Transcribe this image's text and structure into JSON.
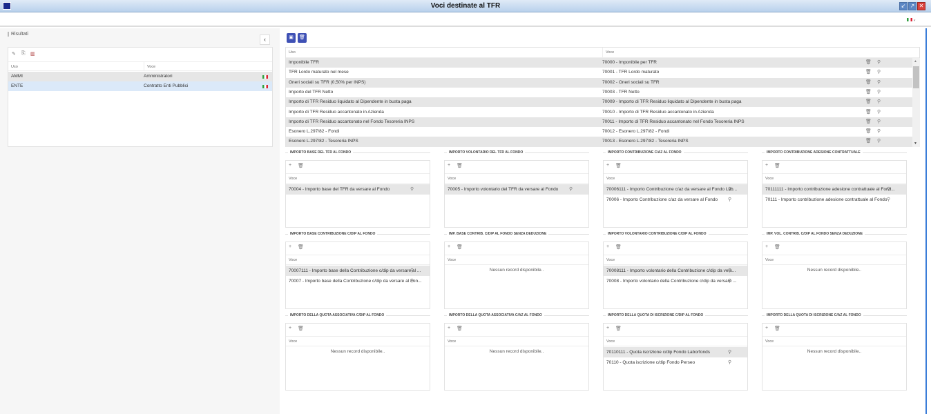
{
  "window": {
    "title": "Voci destinate al TFR",
    "buttons": [
      "restore",
      "maximize",
      "close"
    ]
  },
  "topbar": {
    "language": "it",
    "language_arrow": "▾"
  },
  "left": {
    "title": "Risultati",
    "collapse_label": "‹",
    "columns": [
      "Uso",
      "Voce"
    ],
    "rows": [
      {
        "uso": "AMMI",
        "voce": "Amministratori"
      },
      {
        "uso": "ENTE",
        "voce": "Contratto Enti Pubblici"
      }
    ]
  },
  "main": {
    "columns": [
      "Uso",
      "Voce"
    ],
    "rows": [
      {
        "uso": "Imponibile TFR",
        "voce": "70000 - Imponibile per TFR"
      },
      {
        "uso": "TFR Lordo maturato nel mese",
        "voce": "70001 - TFR Lordo maturato"
      },
      {
        "uso": "Oneri sociali su TFR (0,50% per INPS)",
        "voce": "70002 - Oneri sociali su TFR"
      },
      {
        "uso": "Importo del TFR Netto",
        "voce": "70003 - TFR Netto"
      },
      {
        "uso": "Importo di TFR Residuo liquidato al Dipendente in busta paga",
        "voce": "70009 - Importo di TFR Residuo liquidato al Dipendente in busta paga"
      },
      {
        "uso": "Importo di TFR Residuo accantonato in Azienda",
        "voce": "70010 - Importo di TFR Residuo accantonato in Azienda"
      },
      {
        "uso": "Importo di TFR Residuo accantonato nel Fondo Tesoreria INPS",
        "voce": "70011 - Importo di TFR Residuo accantonato nel Fondo Tesoreria INPS"
      },
      {
        "uso": "Esonero L.297/82 - Fondi",
        "voce": "70012 - Esonero L.297/82 - Fondi"
      },
      {
        "uso": "Esonero L.297/82 - Tesoreria INPS",
        "voce": "70013 - Esonero L.297/82 - Tesoreria INPS"
      }
    ]
  },
  "panels": [
    {
      "title": "IMPORTO BASE DEL TFR AL FONDO",
      "header": "Voce",
      "rows": [
        "70004 - Importo base del TFR da versare al Fondo"
      ]
    },
    {
      "title": "IMPORTO VOLONTARIO DEL TFR AL FONDO",
      "header": "Voce",
      "rows": [
        "70005 - Importo volontario del TFR da versare al Fondo"
      ]
    },
    {
      "title": "IMPORTO CONTRIBUZIONE C/AZ AL FONDO",
      "header": "Voce",
      "rows": [
        "70006111 - Importo Contribuzione c/az da versare al Fondo Lab...",
        "70006 - Importo Contribuzione c/az da versare al Fondo"
      ]
    },
    {
      "title": "IMPORTO CONTRIBUZIONE ADESIONE CONTRATTUALE",
      "header": "Voce",
      "rows": [
        "70111111 - Importo contribuzione adesione contrattuale al Fond...",
        "70111 - Importo contribuzione adesione contrattuale al Fondo"
      ]
    },
    {
      "title": "IMPORTO BASE CONTRIBUZIONE C/DIP AL FONDO",
      "header": "Voce",
      "rows": [
        "70007111 - Importo base della Contribuzione c/dip da versare al ...",
        "70007 - Importo base della Contribuzione c/dip da versare al Fon..."
      ]
    },
    {
      "title": "IMP. BASE CONTRIB. C/DIP AL FONDO SENZA DEDUZIONE",
      "header": "Voce",
      "rows": [],
      "empty": "Nessun record disponibile.."
    },
    {
      "title": "IMPORTO VOLONTARIO CONTRIBUZIONE C/DIP AL FONDO",
      "header": "Voce",
      "rows": [
        "70008111 - Importo volontario della Contribuzione c/dip da vers...",
        "70008 - Importo volontario della Contribuzione c/dip da versare ..."
      ]
    },
    {
      "title": "IMP. VOL. CONTRIB. C/DIP AL FONDO SENZA DEDUZIONE",
      "header": "Voce",
      "rows": [],
      "empty": "Nessun record disponibile.."
    },
    {
      "title": "IMPORTO DELLA QUOTA ASSOCIATIVA C/DIP AL FONDO",
      "header": "Voce",
      "rows": [],
      "empty": "Nessun record disponibile.."
    },
    {
      "title": "IMPORTO DELLA QUOTA ASSOCIATIVA C/AZ AL FONDO",
      "header": "Voce",
      "rows": [],
      "empty": "Nessun record disponibile.."
    },
    {
      "title": "IMPORTO DELLA QUOTA DI ISCRIZIONE C/DIP AL FONDO",
      "header": "Voce",
      "rows": [
        "70110111 - Quota iscrizione c/dip Fondo Laborfonds",
        "70110 - Quota iscrizione c/dip Fondo Perseo"
      ]
    },
    {
      "title": "IMPORTO DELLA QUOTA DI ISCRIZIONE C/AZ AL FONDO",
      "header": "Voce",
      "rows": [],
      "empty": "Nessun record disponibile.."
    }
  ],
  "colors": {
    "primary": "#3f51b5",
    "selected_row": "#dbe9f9",
    "alt_row": "#e6e6e6"
  }
}
